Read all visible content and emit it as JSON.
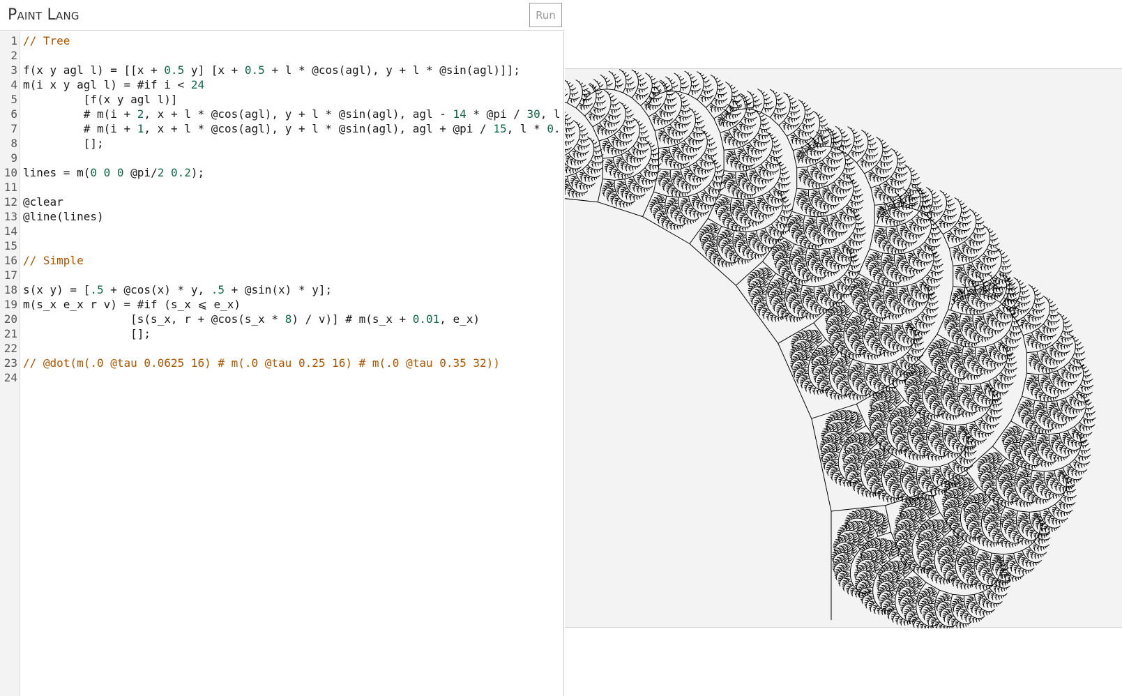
{
  "header": {
    "title": "Paint Lang",
    "run_label": "Run"
  },
  "editor": {
    "lines": [
      "// Tree",
      "",
      "f(x y agl l) = [[x + 0.5 y] [x + 0.5 + l * @cos(agl), y + l * @sin(agl)]];",
      "m(i x y agl l) = #if i < 24",
      "         [f(x y agl l)]",
      "         # m(i + 2, x + l * @cos(agl), y + l * @sin(agl), agl - 14 * @pi / 30, l",
      "         # m(i + 1, x + l * @cos(agl), y + l * @sin(agl), agl + @pi / 15, l * 0.",
      "         [];",
      "",
      "lines = m(0 0 0 @pi/2 0.2);",
      "",
      "@clear",
      "@line(lines)",
      "",
      "",
      "// Simple",
      "",
      "s(x y) = [.5 + @cos(x) * y, .5 + @sin(x) * y];",
      "m(s_x e_x r v) = #if (s_x ⩽ e_x)",
      "                [s(s_x, r + @cos(s_x * 8) / v)] # m(s_x + 0.01, e_x)",
      "                [];",
      "",
      "// @dot(m(.0 @tau 0.0625 16) # m(.0 @tau 0.25 16) # m(.0 @tau 0.35 32))",
      ""
    ]
  },
  "canvas": {
    "background": "#f3f3f3",
    "stroke": "#000000",
    "picture": "recursive fractal fern tree"
  },
  "colors": {
    "number": "#116644",
    "comment": "#aa5500",
    "text": "#1a1a1a"
  }
}
